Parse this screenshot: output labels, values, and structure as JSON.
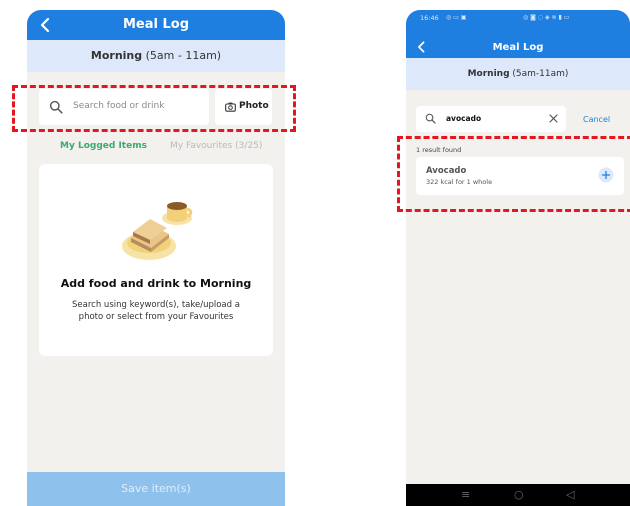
{
  "left": {
    "header": {
      "title": "Meal Log"
    },
    "subheader": {
      "period_bold": "Morning",
      "period_range": " (5am - 11am)"
    },
    "search": {
      "placeholder": "Search food or drink"
    },
    "photo_button": {
      "label": "Photo"
    },
    "tabs": {
      "logged": "My Logged Items",
      "favourites": "My Favourites (3/25)"
    },
    "empty_state": {
      "title": "Add food and drink to Morning",
      "body": "Search using keyword(s), take/upload a photo or select from your Favourites"
    },
    "save_button": {
      "label": "Save item(s)"
    }
  },
  "right": {
    "status_bar": {
      "time": "16:46"
    },
    "header": {
      "title": "Meal Log"
    },
    "subheader": {
      "period_bold": "Morning",
      "period_range": " (5am-11am)"
    },
    "search": {
      "value": "avocado"
    },
    "cancel": {
      "label": "Cancel"
    },
    "results": {
      "count_text": "1 result found",
      "items": [
        {
          "name": "Avocado",
          "detail": "322 kcal for 1 whole"
        }
      ]
    },
    "nav": {
      "icons": [
        "menu-icon",
        "home-icon",
        "back-icon"
      ]
    }
  },
  "colors": {
    "brand_blue": "#1f7fe0",
    "accent_green": "#3aaa6e",
    "highlight_red": "#e4161f"
  }
}
